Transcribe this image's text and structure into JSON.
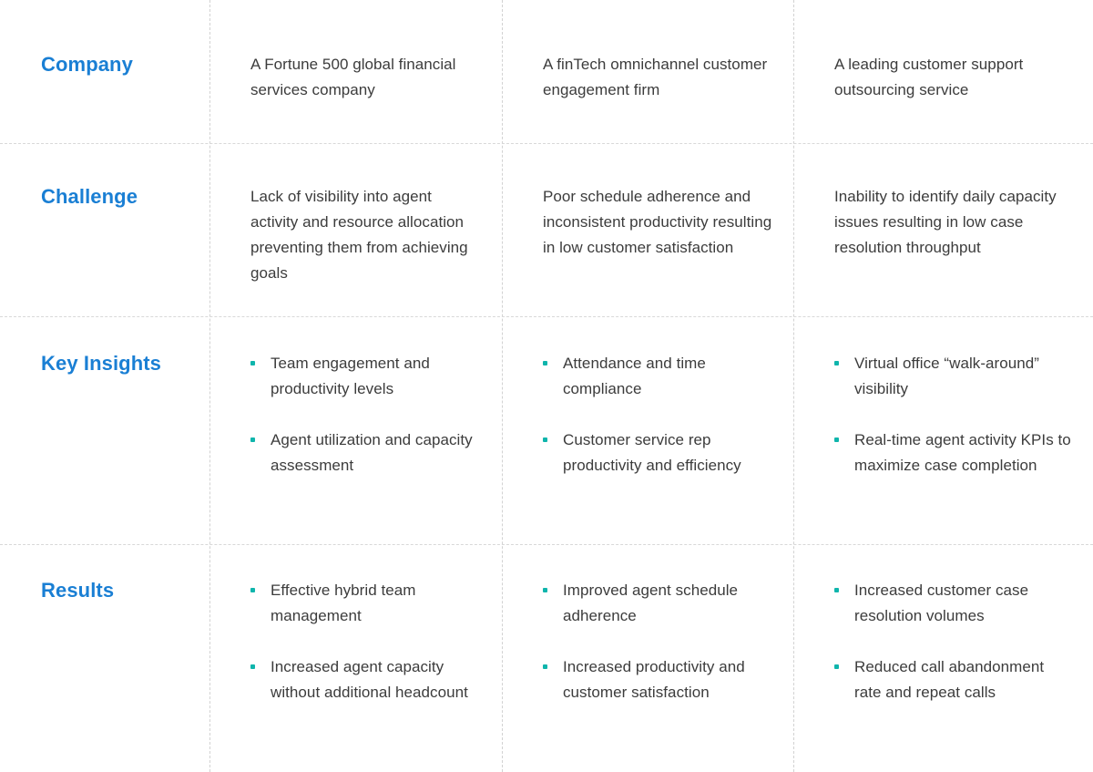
{
  "accent": {
    "label_blue": "#1a7fd4",
    "bullet_teal": "#0fb5ac",
    "body_gray": "#3c3c3c",
    "grid_gray": "#d8d8d8"
  },
  "rows": [
    {
      "label": "Company",
      "type": "text",
      "cells": [
        "A Fortune 500 global financial services company",
        "A finTech omnichannel customer engagement firm",
        "A leading customer support outsourcing service"
      ]
    },
    {
      "label": "Challenge",
      "type": "text",
      "cells": [
        "Lack of visibility into agent activity and resource allocation preventing them from achieving goals",
        "Poor schedule adherence and inconsistent productivity resulting in low customer satisfaction",
        "Inability to identify daily capacity issues resulting in low case resolution throughput"
      ]
    },
    {
      "label": "Key Insights",
      "type": "bullets",
      "cells": [
        [
          "Team engagement and productivity levels",
          "Agent utilization and capacity assessment"
        ],
        [
          "Attendance and time compliance",
          "Customer service rep productivity and efficiency"
        ],
        [
          "Virtual office “walk-around” visibility",
          "Real-time agent activity KPIs to maximize case completion"
        ]
      ]
    },
    {
      "label": "Results",
      "type": "bullets",
      "cells": [
        [
          "Effective hybrid team management",
          "Increased agent capacity without additional headcount"
        ],
        [
          "Improved agent schedule adherence",
          "Increased productivity and customer satisfaction"
        ],
        [
          "Increased customer case resolution volumes",
          "Reduced call abandonment rate and repeat calls"
        ]
      ]
    }
  ]
}
